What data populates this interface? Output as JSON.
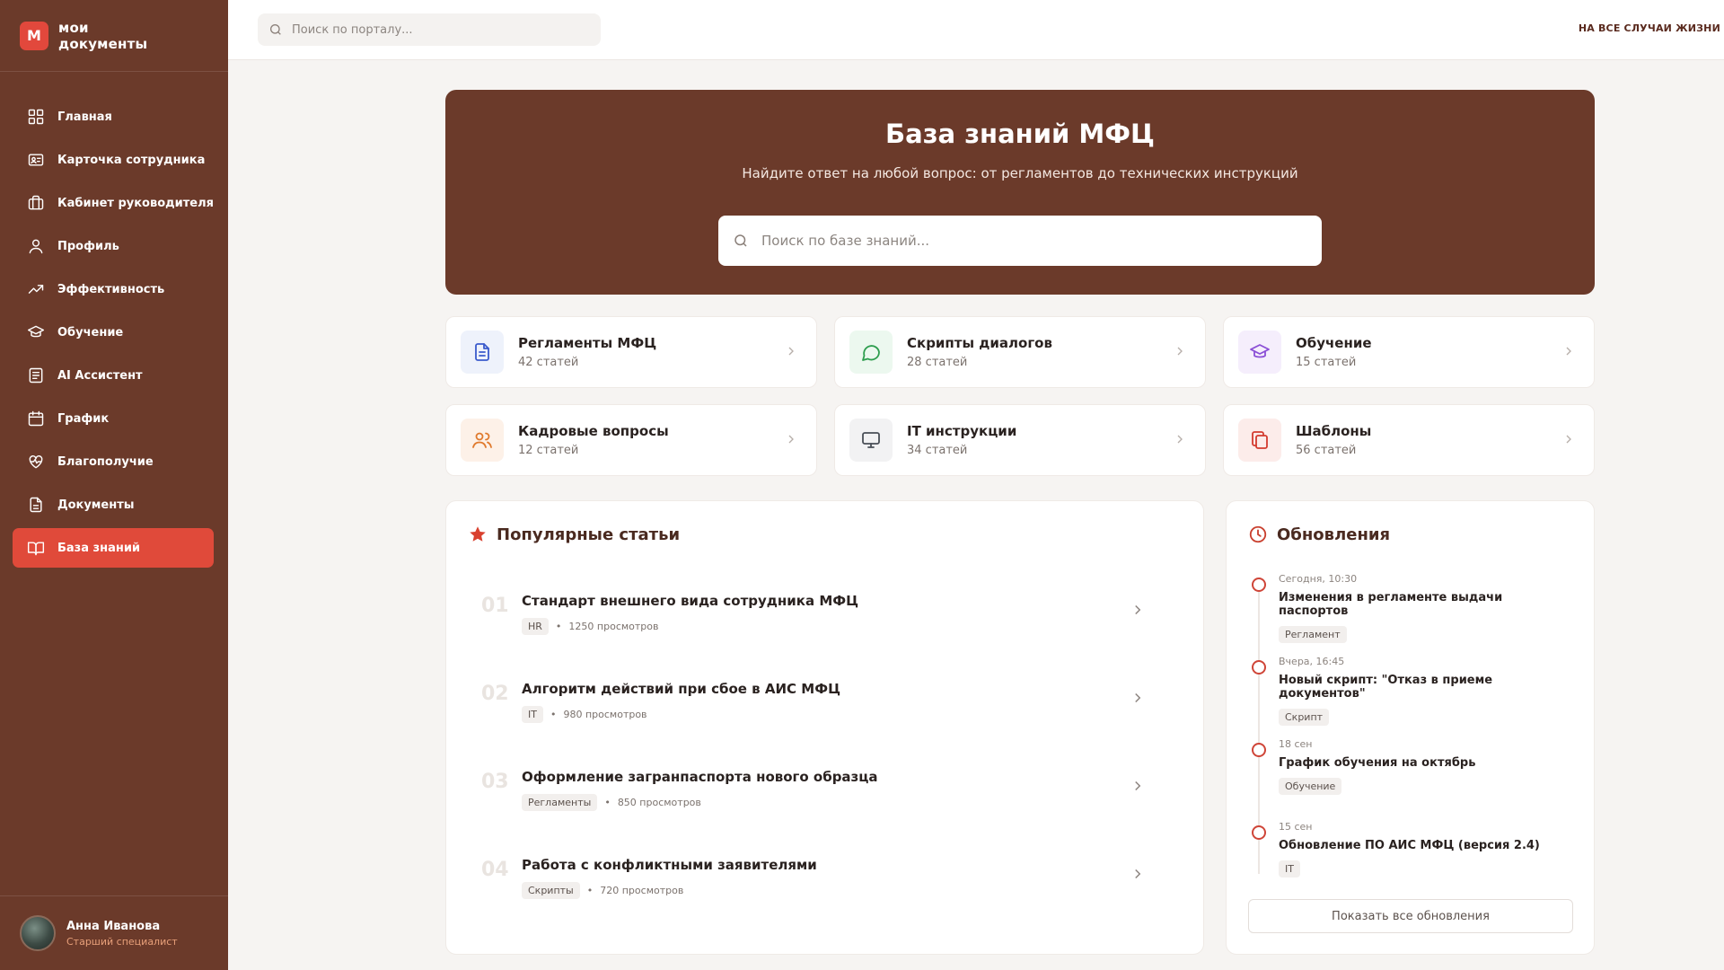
{
  "app": {
    "logo_letter": "М",
    "logo_line1": "мои",
    "logo_line2": "документы"
  },
  "sidebar": {
    "items": [
      {
        "label": "Главная",
        "icon": "grid-icon"
      },
      {
        "label": "Карточка сотрудника",
        "icon": "id-card-icon"
      },
      {
        "label": "Кабинет руководителя",
        "icon": "briefcase-icon"
      },
      {
        "label": "Профиль",
        "icon": "user-icon"
      },
      {
        "label": "Эффективность",
        "icon": "trending-up-icon"
      },
      {
        "label": "Обучение",
        "icon": "graduation-cap-icon"
      },
      {
        "label": "AI Ассистент",
        "icon": "message-square-icon"
      },
      {
        "label": "График",
        "icon": "calendar-icon"
      },
      {
        "label": "Благополучие",
        "icon": "heart-pulse-icon"
      },
      {
        "label": "Документы",
        "icon": "document-icon"
      },
      {
        "label": "База знаний",
        "icon": "book-open-icon",
        "active": true
      }
    ],
    "user": {
      "name": "Анна Иванова",
      "role": "Старший специалист"
    }
  },
  "topbar": {
    "search_placeholder": "Поиск по порталу...",
    "right_text": "НА ВСЕ СЛУЧАИ ЖИЗНИ"
  },
  "hero": {
    "title": "База знаний МФЦ",
    "subtitle": "Найдите ответ на любой вопрос: от регламентов до технических инструкций",
    "search_placeholder": "Поиск по базе знаний..."
  },
  "categories": [
    {
      "title": "Регламенты МФЦ",
      "count": "42 статей",
      "icon": "file-text-icon",
      "bg": "#eef2fb",
      "color": "#3b5bcc"
    },
    {
      "title": "Скрипты диалогов",
      "count": "28 статей",
      "icon": "message-circle-icon",
      "bg": "#ecf8ef",
      "color": "#2f9e4f"
    },
    {
      "title": "Обучение",
      "count": "15 статей",
      "icon": "graduation-cap-icon",
      "bg": "#f5eefc",
      "color": "#8b4fd6"
    },
    {
      "title": "Кадровые вопросы",
      "count": "12 статей",
      "icon": "users-icon",
      "bg": "#fdf1e8",
      "color": "#e07a2e"
    },
    {
      "title": "IT инструкции",
      "count": "34 статей",
      "icon": "monitor-icon",
      "bg": "#f2f2f3",
      "color": "#4a4f57"
    },
    {
      "title": "Шаблоны",
      "count": "56 статей",
      "icon": "copy-icon",
      "bg": "#fcecea",
      "color": "#d33b2f"
    }
  ],
  "popular": {
    "title": "Популярные статьи",
    "articles": [
      {
        "num": "01",
        "title": "Стандарт внешнего вида сотрудника МФЦ",
        "tag": "HR",
        "views": "1250 просмотров"
      },
      {
        "num": "02",
        "title": "Алгоритм действий при сбое в АИС МФЦ",
        "tag": "IT",
        "views": "980 просмотров"
      },
      {
        "num": "03",
        "title": "Оформление загранпаспорта нового образца",
        "tag": "Регламенты",
        "views": "850 просмотров"
      },
      {
        "num": "04",
        "title": "Работа с конфликтными заявителями",
        "tag": "Скрипты",
        "views": "720 просмотров"
      }
    ]
  },
  "updates": {
    "title": "Обновления",
    "items": [
      {
        "date": "Сегодня, 10:30",
        "title": "Изменения в регламенте выдачи паспортов",
        "tag": "Регламент"
      },
      {
        "date": "Вчера, 16:45",
        "title": "Новый скрипт: \"Отказ в приеме документов\"",
        "tag": "Скрипт"
      },
      {
        "date": "18 сен",
        "title": "График обучения на октябрь",
        "tag": "Обучение"
      },
      {
        "date": "15 сен",
        "title": "Обновление ПО АИС МФЦ (версия 2.4)",
        "tag": "IT"
      }
    ],
    "show_all_label": "Показать все обновления"
  },
  "colors": {
    "brand_brown": "#6b3a2a",
    "accent_red": "#e04a3a"
  }
}
